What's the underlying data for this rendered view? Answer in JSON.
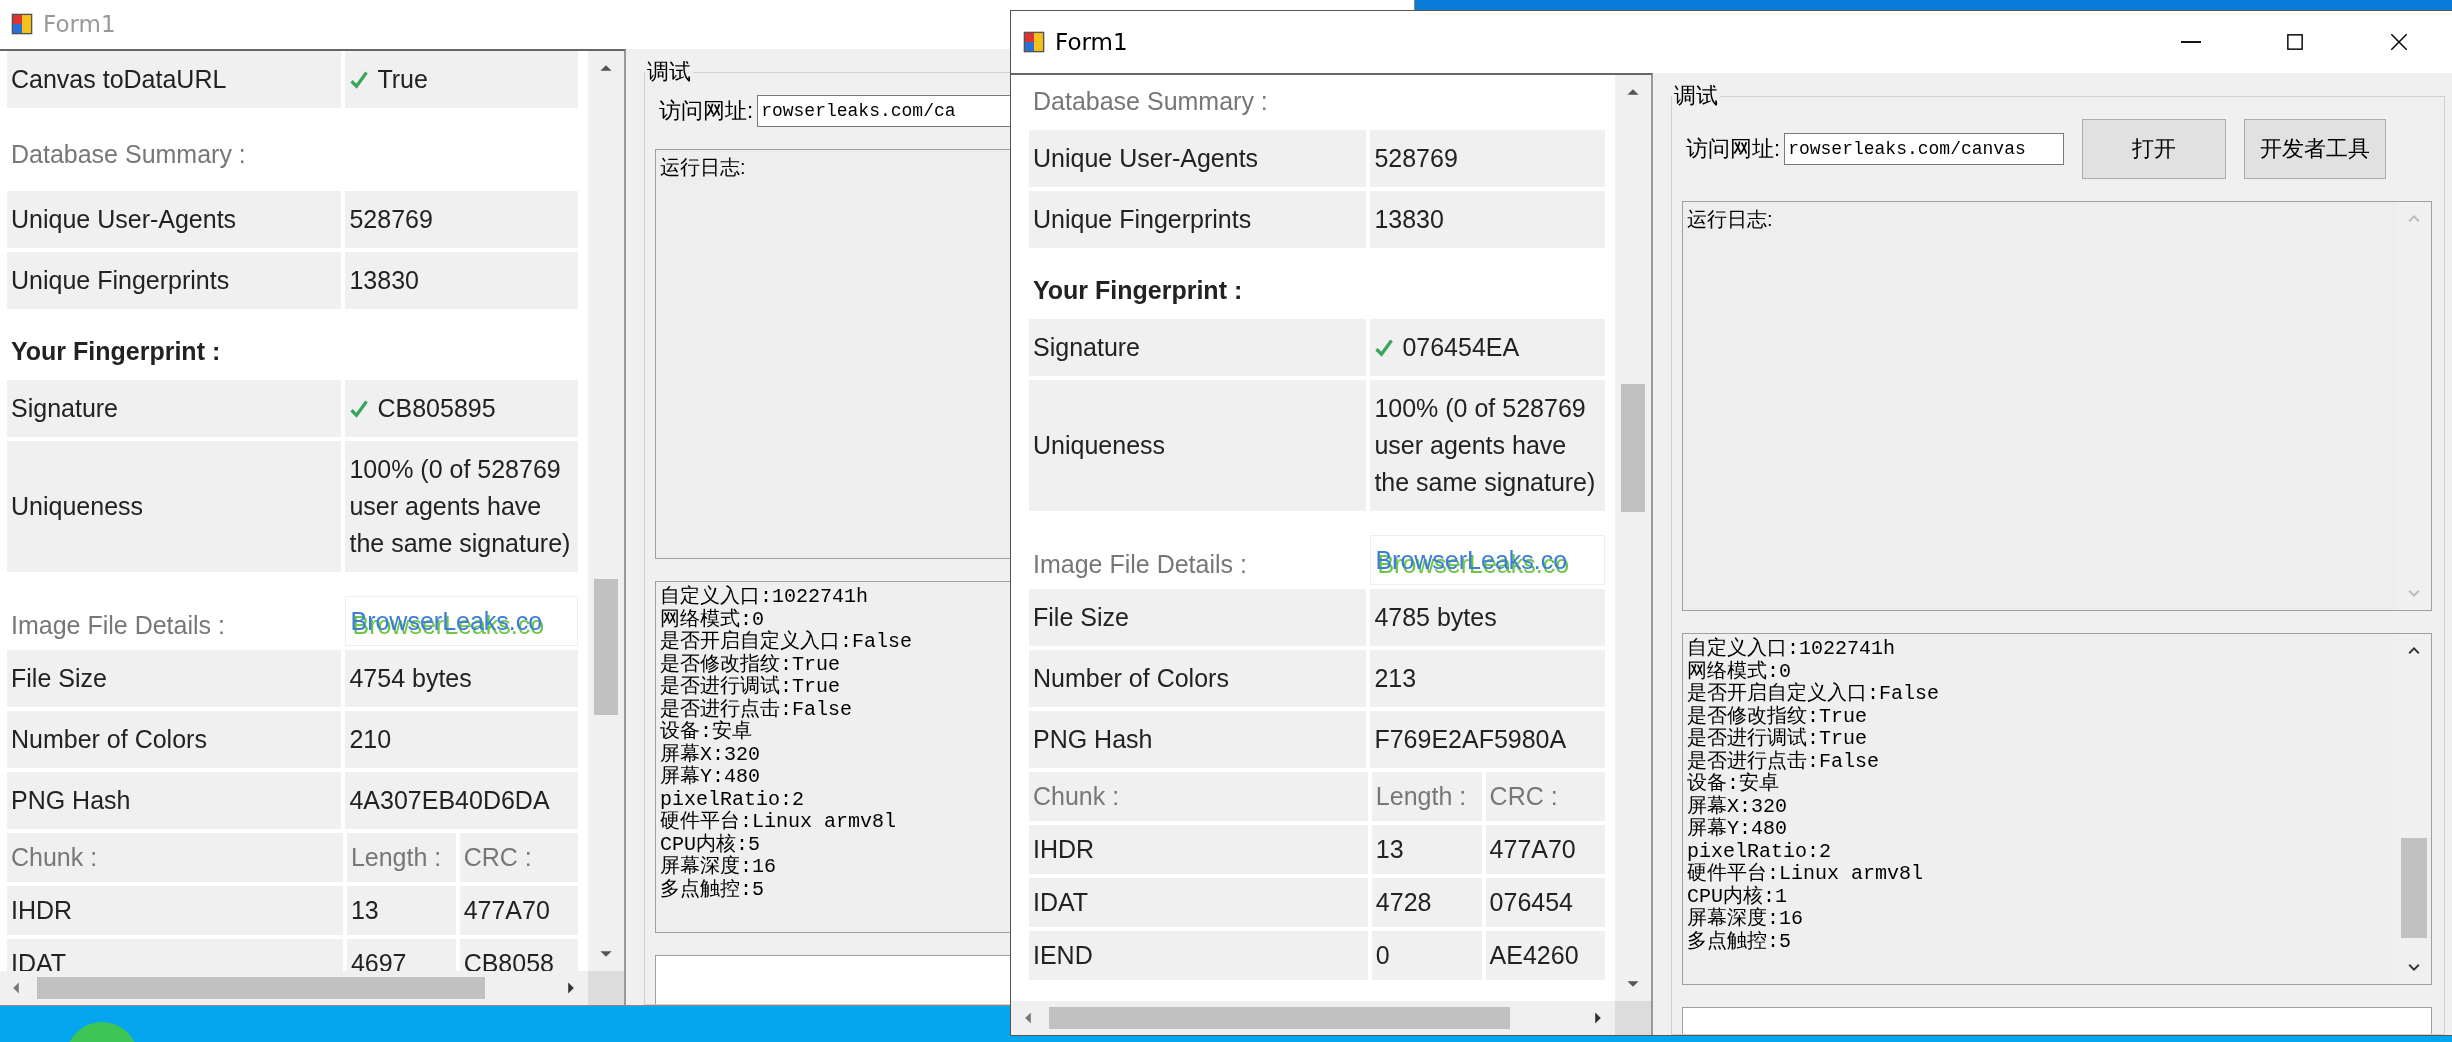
{
  "windows": [
    {
      "title": "Form1",
      "active": false,
      "browser": {
        "rows": [
          {
            "kind": "pair",
            "label": "Canvas toDataURL",
            "value": "True",
            "verified": true
          },
          {
            "kind": "caption",
            "text": "Database Summary :"
          },
          {
            "kind": "pair",
            "label": "Unique User-Agents",
            "value": "528769",
            "verified": false
          },
          {
            "kind": "pair",
            "label": "Unique Fingerprints",
            "value": "13830",
            "verified": false
          },
          {
            "kind": "heading",
            "text": "Your Fingerprint :"
          },
          {
            "kind": "pair",
            "label": "Signature",
            "value": "CB805895",
            "verified": true
          },
          {
            "kind": "pair",
            "label": "Uniqueness",
            "value": "100% (0 of 528769 user agents have the same signature)",
            "verified": false
          },
          {
            "kind": "image",
            "label": "Image File Details :",
            "image_text": "BrowserLeaks.co"
          },
          {
            "kind": "pair",
            "label": "File Size",
            "value": "4754 bytes",
            "verified": false
          },
          {
            "kind": "pair",
            "label": "Number of Colors",
            "value": "210",
            "verified": false
          },
          {
            "kind": "pair",
            "label": "PNG Hash",
            "value": "4A307EB40D6DA",
            "verified": false
          },
          {
            "kind": "chunk_header",
            "cells": [
              "Chunk :",
              "Length :",
              "CRC :"
            ]
          },
          {
            "kind": "chunk",
            "cells": [
              "IHDR",
              "13",
              "477A70"
            ]
          },
          {
            "kind": "chunk",
            "cells": [
              "IDAT",
              "4697",
              "CB8058"
            ]
          }
        ]
      },
      "debug": {
        "group_title": "调试",
        "url_label": "访问网址:",
        "url": "rowserleaks.com/ca",
        "log_title": "运行日志:",
        "log": [
          "自定义入口:1022741h",
          "网络模式:0",
          "是否开启自定义入口:False",
          "是否修改指纹:True",
          "是否进行调试:True",
          "是否进行点击:False",
          "设备:安卓",
          "屏幕X:320",
          "屏幕Y:480",
          "pixelRatio:2",
          "硬件平台:Linux armv8l",
          "CPU内核:5",
          "屏幕深度:16",
          "多点触控:5"
        ]
      }
    },
    {
      "title": "Form1",
      "active": true,
      "browser": {
        "rows": [
          {
            "kind": "caption",
            "text": "Database Summary :"
          },
          {
            "kind": "pair",
            "label": "Unique User-Agents",
            "value": "528769",
            "verified": false
          },
          {
            "kind": "pair",
            "label": "Unique Fingerprints",
            "value": "13830",
            "verified": false
          },
          {
            "kind": "heading",
            "text": "Your Fingerprint :"
          },
          {
            "kind": "pair",
            "label": "Signature",
            "value": "076454EA",
            "verified": true
          },
          {
            "kind": "pair",
            "label": "Uniqueness",
            "value": "100% (0 of 528769 user agents have the same signature)",
            "verified": false
          },
          {
            "kind": "image",
            "label": "Image File Details :",
            "image_text": "BrowserLeaks.co"
          },
          {
            "kind": "pair",
            "label": "File Size",
            "value": "4785 bytes",
            "verified": false
          },
          {
            "kind": "pair",
            "label": "Number of Colors",
            "value": "213",
            "verified": false
          },
          {
            "kind": "pair",
            "label": "PNG Hash",
            "value": "F769E2AF5980A",
            "verified": false
          },
          {
            "kind": "chunk_header",
            "cells": [
              "Chunk :",
              "Length :",
              "CRC :"
            ]
          },
          {
            "kind": "chunk",
            "cells": [
              "IHDR",
              "13",
              "477A70"
            ]
          },
          {
            "kind": "chunk",
            "cells": [
              "IDAT",
              "4728",
              "076454"
            ]
          },
          {
            "kind": "chunk",
            "cells": [
              "IEND",
              "0",
              "AE4260"
            ]
          }
        ]
      },
      "debug": {
        "group_title": "调试",
        "url_label": "访问网址:",
        "url": "rowserleaks.com/canvas",
        "buttons": [
          "打开",
          "开发者工具"
        ],
        "log_title": "运行日志:",
        "log": [
          "自定义入口:1022741h",
          "网络模式:0",
          "是否开启自定义入口:False",
          "是否修改指纹:True",
          "是否进行调试:True",
          "是否进行点击:False",
          "设备:安卓",
          "屏幕X:320",
          "屏幕Y:480",
          "pixelRatio:2",
          "硬件平台:Linux armv8l",
          "CPU内核:1",
          "屏幕深度:16",
          "多点触控:5"
        ]
      }
    }
  ]
}
